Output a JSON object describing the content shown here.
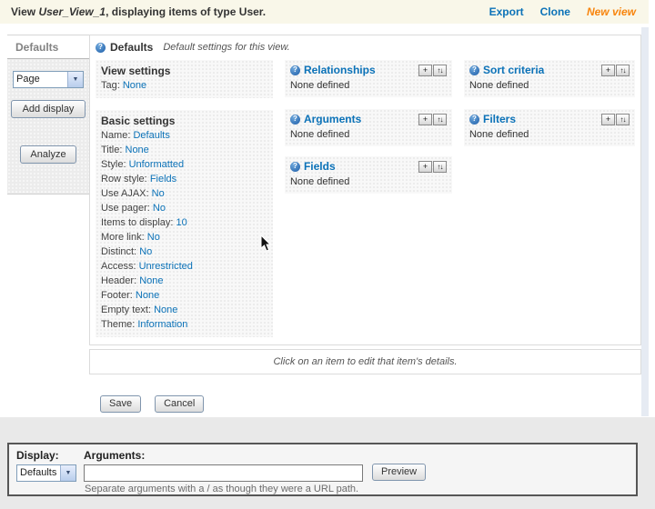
{
  "icons": {
    "help": "?",
    "add": "+",
    "rearrange": "↑↓",
    "dropdown_arrow": "▼"
  },
  "colors": {
    "link_blue": "#0b72b8",
    "accent_orange": "#f8840c",
    "header_cream": "#f9f7e9",
    "grey_band": "#e9e9e9"
  },
  "header": {
    "title_prefix": "View ",
    "view_name": "User_View_1",
    "title_suffix": ", displaying items of type User.",
    "links": [
      {
        "label": "Export"
      },
      {
        "label": "Clone"
      },
      {
        "label": "New view"
      }
    ]
  },
  "sidebar": {
    "tab_label": "Defaults",
    "display_type_value": "Page",
    "add_display_label": "Add display",
    "analyze_label": "Analyze"
  },
  "display": {
    "title": "Defaults",
    "description": "Default settings for this view.",
    "note": "Click on an item to edit that item's details."
  },
  "view_settings": {
    "title": "View settings",
    "rows": [
      {
        "label": "Tag:",
        "value": "None"
      }
    ]
  },
  "basic_settings": {
    "title": "Basic settings",
    "rows": [
      {
        "label": "Name:",
        "value": "Defaults"
      },
      {
        "label": "Title:",
        "value": "None"
      },
      {
        "label": "Style:",
        "value": "Unformatted"
      },
      {
        "label": "Row style:",
        "value": "Fields"
      },
      {
        "label": "Use AJAX:",
        "value": "No"
      },
      {
        "label": "Use pager:",
        "value": "No"
      },
      {
        "label": "Items to display:",
        "value": "10"
      },
      {
        "label": "More link:",
        "value": "No"
      },
      {
        "label": "Distinct:",
        "value": "No"
      },
      {
        "label": "Access:",
        "value": "Unrestricted"
      },
      {
        "label": "Header:",
        "value": "None"
      },
      {
        "label": "Footer:",
        "value": "None"
      },
      {
        "label": "Empty text:",
        "value": "None"
      },
      {
        "label": "Theme:",
        "value": "Information"
      }
    ]
  },
  "buckets": [
    {
      "title": "Relationships",
      "empty": "None defined"
    },
    {
      "title": "Arguments",
      "empty": "None defined"
    },
    {
      "title": "Fields",
      "empty": "None defined"
    },
    {
      "title": "Sort criteria",
      "empty": "None defined"
    },
    {
      "title": "Filters",
      "empty": "None defined"
    }
  ],
  "actions": {
    "save_label": "Save",
    "cancel_label": "Cancel"
  },
  "preview": {
    "display_label": "Display:",
    "display_value": "Defaults",
    "arguments_label": "Arguments:",
    "arguments_value": "",
    "preview_label": "Preview",
    "help_text": "Separate arguments with a / as though they were a URL path."
  }
}
